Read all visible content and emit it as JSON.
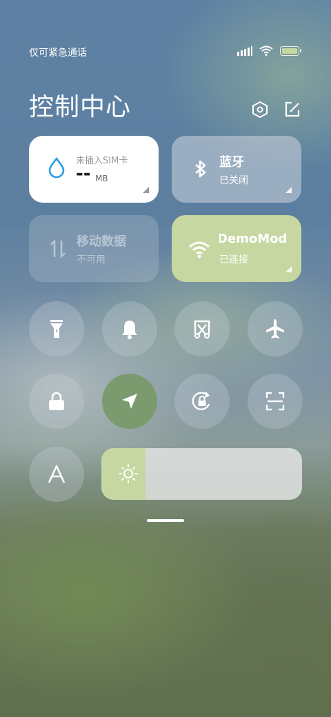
{
  "status_bar": {
    "carrier_text": "仅可紧急通话",
    "icons": [
      "signal-icon",
      "wifi-icon",
      "battery-icon"
    ]
  },
  "header": {
    "title": "控制中心",
    "icons": [
      "settings-icon",
      "edit-icon"
    ]
  },
  "tiles": {
    "data_usage": {
      "label": "未插入SIM卡",
      "value": "--",
      "unit": "MB",
      "icon": "water-drop-icon"
    },
    "bluetooth": {
      "label": "蓝牙",
      "status": "已关闭",
      "icon": "bluetooth-icon"
    },
    "mobile_data": {
      "label": "移动数据",
      "status": "不可用",
      "icon": "data-arrows-icon"
    },
    "wifi": {
      "label": "DemoMod",
      "status": "已连接",
      "icon": "wifi-icon"
    }
  },
  "toggles_row1": [
    "flashlight-icon",
    "bell-icon",
    "screenshot-icon",
    "airplane-icon"
  ],
  "toggles_row2": [
    "lock-icon",
    "location-icon",
    "rotation-lock-icon",
    "scan-icon"
  ],
  "bottom_row": {
    "font_icon": "font-size-icon",
    "brightness_level": 0.22,
    "brightness_icon": "sun-icon"
  },
  "colors": {
    "accent_green": "#c6d7a2",
    "location_active": "#7b9a6e",
    "tile_white": "#ffffff"
  }
}
